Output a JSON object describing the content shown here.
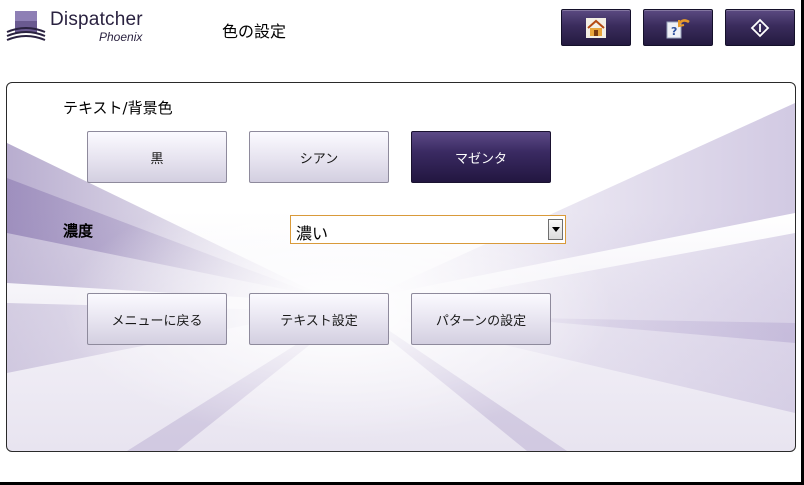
{
  "app": {
    "name": "Dispatcher",
    "subname": "Phoenix",
    "title": "色の設定"
  },
  "header_buttons": [
    {
      "name": "home-button",
      "icon": "home-icon"
    },
    {
      "name": "back-button",
      "icon": "back-icon"
    },
    {
      "name": "start-button",
      "icon": "diamond-start-icon"
    }
  ],
  "color_section": {
    "label": "テキスト/背景色",
    "options": [
      "黒",
      "シアン",
      "マゼンタ"
    ],
    "selected": "マゼンタ"
  },
  "density": {
    "label": "濃度",
    "value": "濃い"
  },
  "actions": {
    "back_to_menu": "メニューに戻る",
    "text_settings": "テキスト設定",
    "pattern_settings": "パターンの設定"
  },
  "colors": {
    "accent": "#2e2150",
    "select_border": "#d99a3a"
  }
}
